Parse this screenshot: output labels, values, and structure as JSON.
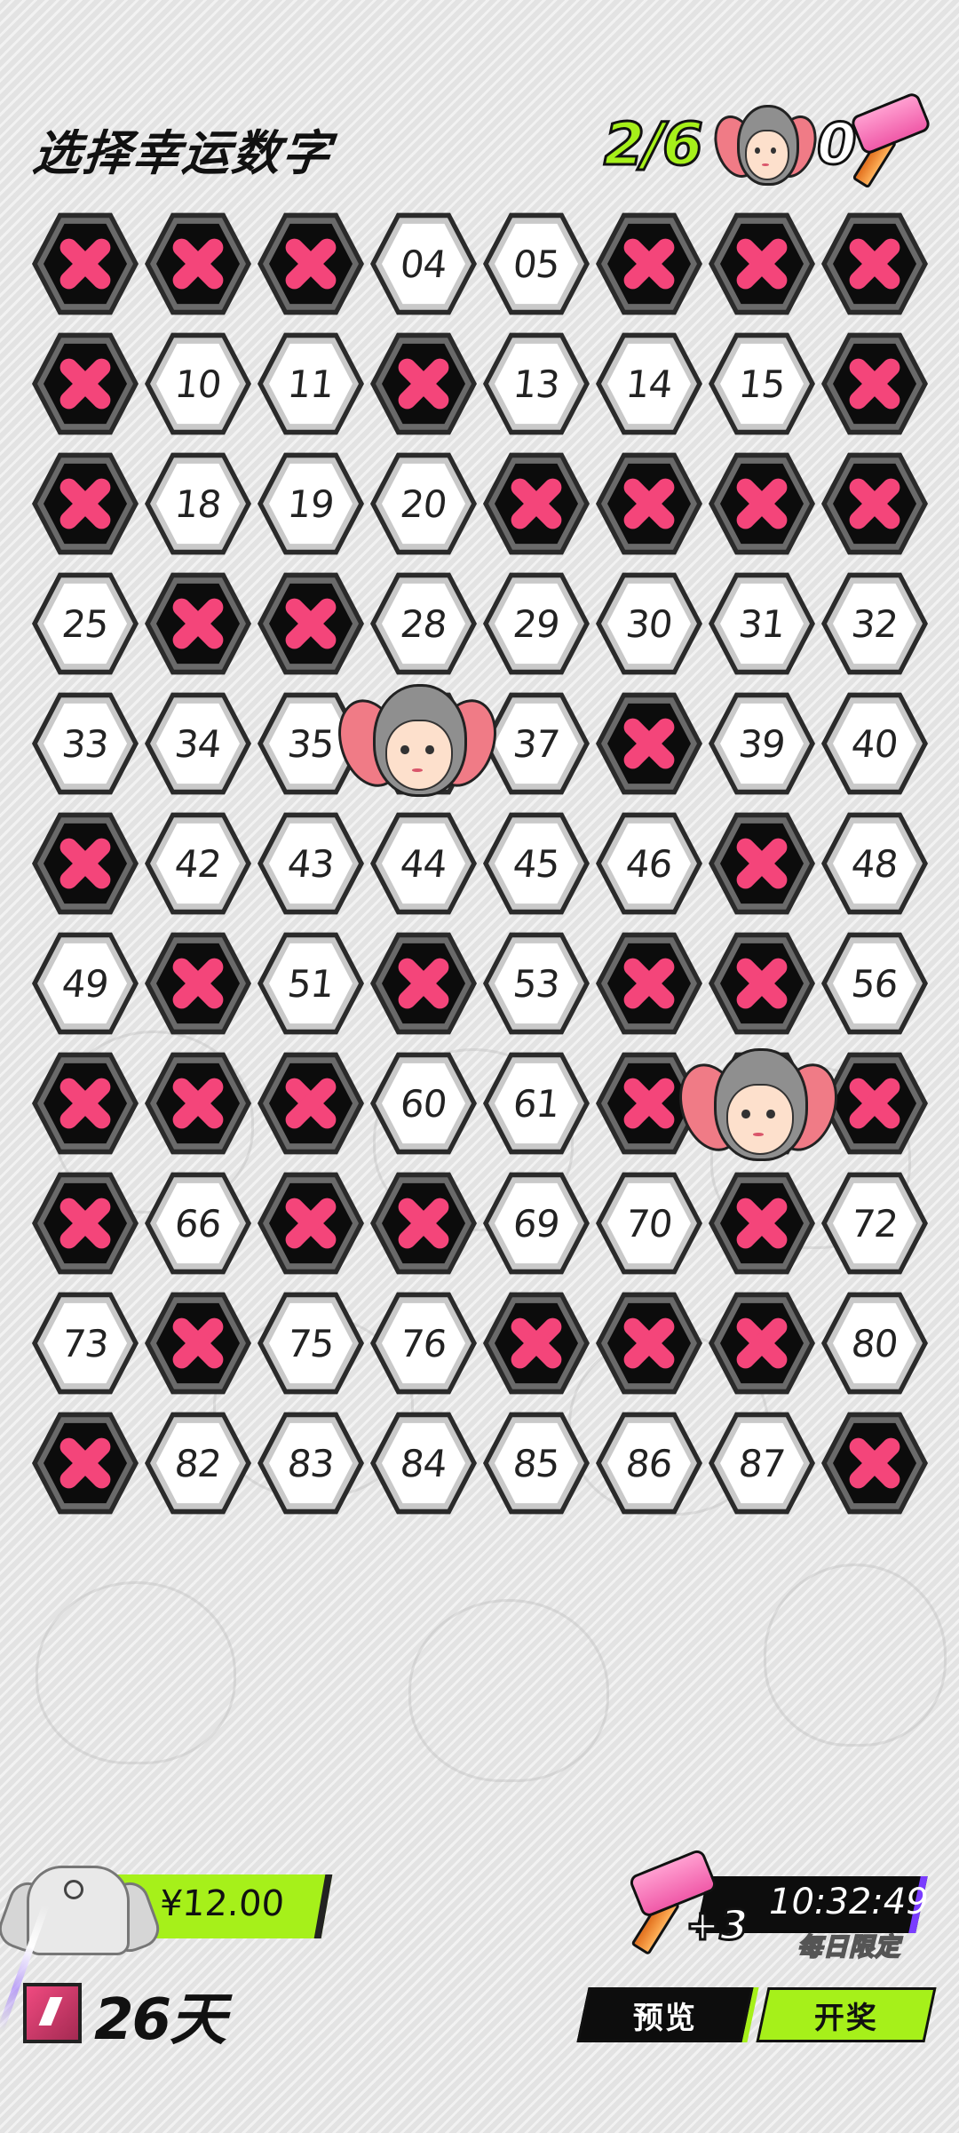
{
  "header": {
    "title": "选择幸运数字",
    "selected_count": "2/6",
    "hammer_count": "0"
  },
  "grid": {
    "columns": 8,
    "cells": [
      {
        "label": "",
        "crossed": true
      },
      {
        "label": "",
        "crossed": true
      },
      {
        "label": "",
        "crossed": true
      },
      {
        "label": "04",
        "crossed": false
      },
      {
        "label": "05",
        "crossed": false
      },
      {
        "label": "",
        "crossed": true
      },
      {
        "label": "",
        "crossed": true
      },
      {
        "label": "",
        "crossed": true
      },
      {
        "label": "",
        "crossed": true
      },
      {
        "label": "10",
        "crossed": false
      },
      {
        "label": "11",
        "crossed": false
      },
      {
        "label": "",
        "crossed": true
      },
      {
        "label": "13",
        "crossed": false
      },
      {
        "label": "14",
        "crossed": false
      },
      {
        "label": "15",
        "crossed": false
      },
      {
        "label": "",
        "crossed": true
      },
      {
        "label": "",
        "crossed": true
      },
      {
        "label": "18",
        "crossed": false
      },
      {
        "label": "19",
        "crossed": false
      },
      {
        "label": "20",
        "crossed": false
      },
      {
        "label": "",
        "crossed": true
      },
      {
        "label": "",
        "crossed": true
      },
      {
        "label": "",
        "crossed": true
      },
      {
        "label": "",
        "crossed": true
      },
      {
        "label": "25",
        "crossed": false
      },
      {
        "label": "",
        "crossed": true
      },
      {
        "label": "",
        "crossed": true
      },
      {
        "label": "28",
        "crossed": false
      },
      {
        "label": "29",
        "crossed": false
      },
      {
        "label": "30",
        "crossed": false
      },
      {
        "label": "31",
        "crossed": false
      },
      {
        "label": "32",
        "crossed": false
      },
      {
        "label": "33",
        "crossed": false
      },
      {
        "label": "34",
        "crossed": false
      },
      {
        "label": "35",
        "crossed": false
      },
      {
        "label": "",
        "crossed": false,
        "selected": true
      },
      {
        "label": "37",
        "crossed": false
      },
      {
        "label": "",
        "crossed": true
      },
      {
        "label": "39",
        "crossed": false
      },
      {
        "label": "40",
        "crossed": false
      },
      {
        "label": "",
        "crossed": true
      },
      {
        "label": "42",
        "crossed": false
      },
      {
        "label": "43",
        "crossed": false
      },
      {
        "label": "44",
        "crossed": false
      },
      {
        "label": "45",
        "crossed": false
      },
      {
        "label": "46",
        "crossed": false
      },
      {
        "label": "",
        "crossed": true
      },
      {
        "label": "48",
        "crossed": false
      },
      {
        "label": "49",
        "crossed": false
      },
      {
        "label": "",
        "crossed": true
      },
      {
        "label": "51",
        "crossed": false
      },
      {
        "label": "",
        "crossed": true
      },
      {
        "label": "53",
        "crossed": false
      },
      {
        "label": "",
        "crossed": true
      },
      {
        "label": "",
        "crossed": true
      },
      {
        "label": "56",
        "crossed": false
      },
      {
        "label": "",
        "crossed": true
      },
      {
        "label": "",
        "crossed": true
      },
      {
        "label": "",
        "crossed": true
      },
      {
        "label": "60",
        "crossed": false
      },
      {
        "label": "61",
        "crossed": false
      },
      {
        "label": "",
        "crossed": true
      },
      {
        "label": "",
        "crossed": false,
        "selected": true
      },
      {
        "label": "",
        "crossed": true
      },
      {
        "label": "",
        "crossed": true
      },
      {
        "label": "66",
        "crossed": false
      },
      {
        "label": "",
        "crossed": true
      },
      {
        "label": "",
        "crossed": true
      },
      {
        "label": "69",
        "crossed": false
      },
      {
        "label": "70",
        "crossed": false
      },
      {
        "label": "",
        "crossed": true
      },
      {
        "label": "72",
        "crossed": false
      },
      {
        "label": "73",
        "crossed": false
      },
      {
        "label": "",
        "crossed": true
      },
      {
        "label": "75",
        "crossed": false
      },
      {
        "label": "76",
        "crossed": false
      },
      {
        "label": "",
        "crossed": true
      },
      {
        "label": "",
        "crossed": true
      },
      {
        "label": "",
        "crossed": true
      },
      {
        "label": "80",
        "crossed": false
      },
      {
        "label": "",
        "crossed": true
      },
      {
        "label": "82",
        "crossed": false
      },
      {
        "label": "83",
        "crossed": false
      },
      {
        "label": "84",
        "crossed": false
      },
      {
        "label": "85",
        "crossed": false
      },
      {
        "label": "86",
        "crossed": false
      },
      {
        "label": "87",
        "crossed": false
      },
      {
        "label": "",
        "crossed": true
      }
    ]
  },
  "bottom": {
    "price": "¥12.00",
    "days": "26天",
    "bonus": "+3",
    "timer": "10:32:49",
    "limit_text": "每日限定",
    "preview_label": "预览",
    "draw_label": "开奖"
  },
  "colors": {
    "accent_green": "#a6f01a",
    "cross_pink": "#f4457a",
    "purple": "#7a3cff"
  },
  "icons": [
    "hammer-icon",
    "character-face-icon",
    "jacket-icon",
    "day-badge-icon",
    "cross-icon"
  ]
}
